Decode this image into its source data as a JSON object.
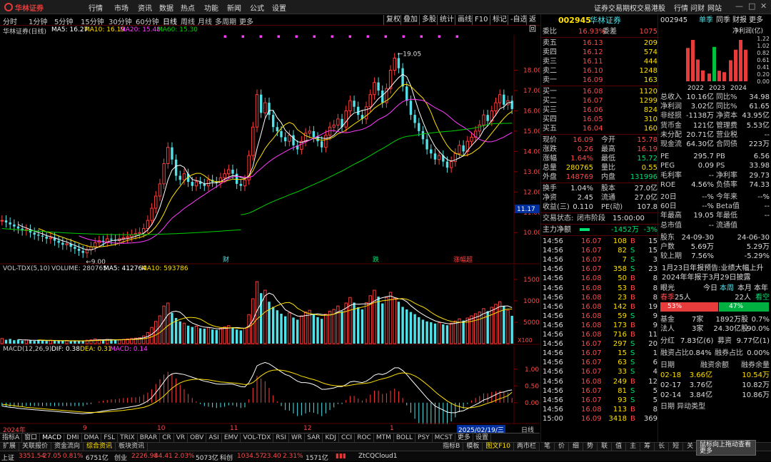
{
  "app": {
    "logo_text": "华林证券",
    "menus": [
      "行情",
      "市场",
      "资讯",
      "数据",
      "热点",
      "功能",
      "新闻",
      "公式",
      "设置"
    ],
    "right_menus": [
      "证券交易",
      "期权交易",
      "港股",
      "行情",
      "问财",
      "网站"
    ]
  },
  "periods": [
    "分时",
    "1分钟",
    "5分钟",
    "15分钟",
    "30分钟",
    "60分钟",
    "日线",
    "周线",
    "月线",
    "多周期",
    "更多"
  ],
  "active_period": "日线",
  "tools": [
    "复权",
    "叠加",
    "多股",
    "统计",
    "画线",
    "F10",
    "标记",
    "-自选",
    "返回"
  ],
  "chart_info": {
    "name": "华林证券(日线)",
    "ma5": "MA5: 16.27",
    "ma10": "MA10: 16.19",
    "ma20": "MA20: 15.48",
    "ma60": "MA60: 15.30",
    "high_label": "19.05",
    "low_label": "9.00",
    "current_price": "11.17",
    "markers": [
      "财",
      "跌",
      "涨幅超"
    ]
  },
  "vol_info": {
    "title": "VOL-TDX(5,10)",
    "volume": "VOLUME: 280765",
    "ma5": "MA5: 412764",
    "ma10": "MA10: 593786",
    "unit": "X100"
  },
  "macd_info": {
    "title": "MACD(12,26,9)",
    "dif": "DIF: 0.38",
    "dea": "DEA: 0.31",
    "macd": "MACD: 0.14"
  },
  "chart_data": [
    {
      "type": "candlestick",
      "title": "华林证券(日线)",
      "ylim": [
        9,
        20
      ],
      "yticks": [
        "18.00",
        "17.00",
        "16.00",
        "15.00",
        "14.00",
        "13.00",
        "12.00",
        "11.00",
        "10.00"
      ],
      "x_labels": [
        "2024年",
        "9",
        "10",
        "11",
        "12",
        "1",
        "2025/02/19/三"
      ],
      "series_names": [
        "MA5",
        "MA10",
        "MA20",
        "MA60"
      ],
      "colors": {
        "up": "#ff3c3c",
        "down": "#52e1e8",
        "ma5": "#ffffff",
        "ma10": "#ffe000",
        "ma20": "#ff3cff",
        "ma60": "#00d000"
      },
      "close": [
        10.6,
        10.5,
        10.4,
        10.3,
        10.2,
        10.1,
        10.15,
        10.0,
        9.9,
        9.85,
        9.8,
        9.7,
        9.75,
        9.6,
        9.5,
        9.4,
        9.45,
        9.3,
        9.2,
        9.1,
        9.0,
        9.15,
        9.3,
        9.5,
        9.6,
        9.55,
        9.7,
        9.65,
        9.6,
        9.7,
        9.75,
        9.8,
        9.9,
        9.95,
        10.0,
        10.2,
        10.6,
        11.2,
        11.8,
        12.4,
        13.4,
        14.2,
        13.6,
        12.8,
        12.6,
        12.9,
        12.5,
        12.3,
        12.5,
        12.4,
        12.3,
        12.6,
        12.5,
        12.45,
        12.7,
        12.9,
        13.1,
        12.9,
        12.4,
        12.3,
        12.6,
        13.8,
        15.2,
        16.8,
        15.9,
        16.4,
        15.8,
        15.2,
        15.0,
        14.7,
        14.5,
        14.8,
        14.3,
        14.1,
        14.5,
        14.9,
        15.0,
        14.7,
        14.5,
        14.2,
        14.8,
        15.2,
        15.3,
        15.6,
        15.2,
        16.0,
        16.5,
        16.2,
        15.8,
        15.6,
        16.2,
        16.8,
        17.4,
        17.0,
        16.4,
        17.1,
        18.0,
        18.6,
        18.1,
        17.2,
        16.5,
        15.8,
        15.4,
        15.0,
        14.6,
        14.1,
        13.9,
        13.6,
        13.8,
        13.5,
        13.2,
        13.5,
        13.9,
        14.3,
        14.0,
        14.5,
        14.7,
        15.0,
        15.3,
        15.8,
        15.5,
        16.0,
        16.4,
        16.8,
        16.3,
        16.5,
        16.09
      ],
      "volume": [
        1200,
        900,
        1100,
        800,
        950,
        700,
        850,
        750,
        650,
        900,
        700,
        600,
        800,
        650,
        700,
        600,
        750,
        550,
        650,
        700,
        600,
        800,
        900,
        1100,
        950,
        800,
        1000,
        900,
        850,
        950,
        1000,
        1100,
        1200,
        1300,
        1400,
        1800,
        2600,
        3800,
        5200,
        6500,
        8800,
        9500,
        7200,
        6000,
        5200,
        4800,
        4200,
        3900,
        4100,
        3600,
        3500,
        3800,
        3300,
        3200,
        3600,
        3900,
        4200,
        3800,
        3300,
        3100,
        3600,
        6800,
        10500,
        14500,
        11800,
        12500,
        9800,
        8600,
        7800,
        7000,
        6400,
        7200,
        6100,
        5600,
        6500,
        7400,
        7800,
        7000,
        6200,
        5800,
        6900,
        7600,
        8000,
        8800,
        7600,
        9500,
        10800,
        9600,
        8500,
        8000,
        9600,
        11200,
        12500,
        11000,
        9400,
        10800,
        12000,
        10600,
        9800,
        8600,
        8000,
        7400,
        6900,
        6200,
        5600,
        5200,
        5000,
        4700,
        4900,
        4500,
        4300,
        4800,
        5300,
        5800,
        5400,
        6000,
        6500,
        7000,
        7400,
        8200,
        7600,
        8500,
        9200,
        9800,
        8800,
        7800,
        6500
      ],
      "macd_dif": [
        -0.1,
        -0.12,
        -0.14,
        -0.15,
        -0.17,
        -0.18,
        -0.19,
        -0.2,
        -0.21,
        -0.22,
        -0.23,
        -0.24,
        -0.25,
        -0.26,
        -0.27,
        -0.28,
        -0.29,
        -0.3,
        -0.31,
        -0.32,
        -0.33,
        -0.32,
        -0.31,
        -0.29,
        -0.27,
        -0.25,
        -0.23,
        -0.21,
        -0.2,
        -0.18,
        -0.16,
        -0.14,
        -0.12,
        -0.1,
        -0.07,
        -0.02,
        0.05,
        0.15,
        0.3,
        0.45,
        0.62,
        0.78,
        0.86,
        0.88,
        0.86,
        0.84,
        0.8,
        0.76,
        0.72,
        0.68,
        0.64,
        0.62,
        0.59,
        0.56,
        0.55,
        0.55,
        0.56,
        0.55,
        0.52,
        0.48,
        0.47,
        0.6,
        0.82,
        1.1,
        1.16,
        1.2,
        1.16,
        1.08,
        1.0,
        0.92,
        0.84,
        0.8,
        0.72,
        0.64,
        0.6,
        0.6,
        0.58,
        0.54,
        0.48,
        0.4,
        0.4,
        0.42,
        0.44,
        0.48,
        0.48,
        0.54,
        0.62,
        0.64,
        0.62,
        0.6,
        0.64,
        0.72,
        0.82,
        0.86,
        0.84,
        0.88,
        0.96,
        1.04,
        1.04,
        0.96,
        0.84,
        0.7,
        0.56,
        0.42,
        0.28,
        0.14,
        0.02,
        -0.1,
        -0.16,
        -0.22,
        -0.28,
        -0.3,
        -0.3,
        -0.26,
        -0.24,
        -0.18,
        -0.12,
        -0.06,
        0.0,
        0.08,
        0.12,
        0.18,
        0.24,
        0.3,
        0.32,
        0.36,
        0.38
      ],
      "macd_dea": [
        -0.05,
        -0.06,
        -0.08,
        -0.09,
        -0.11,
        -0.12,
        -0.14,
        -0.15,
        -0.16,
        -0.17,
        -0.18,
        -0.19,
        -0.2,
        -0.21,
        -0.22,
        -0.23,
        -0.24,
        -0.25,
        -0.26,
        -0.27,
        -0.28,
        -0.29,
        -0.29,
        -0.29,
        -0.29,
        -0.28,
        -0.27,
        -0.26,
        -0.25,
        -0.24,
        -0.23,
        -0.21,
        -0.2,
        -0.18,
        -0.16,
        -0.14,
        -0.1,
        -0.05,
        0.02,
        0.1,
        0.2,
        0.32,
        0.43,
        0.52,
        0.59,
        0.64,
        0.67,
        0.69,
        0.7,
        0.7,
        0.69,
        0.68,
        0.66,
        0.64,
        0.62,
        0.61,
        0.6,
        0.59,
        0.58,
        0.56,
        0.54,
        0.55,
        0.6,
        0.7,
        0.8,
        0.88,
        0.94,
        0.97,
        0.98,
        0.97,
        0.95,
        0.92,
        0.88,
        0.84,
        0.79,
        0.76,
        0.72,
        0.69,
        0.65,
        0.6,
        0.56,
        0.53,
        0.51,
        0.5,
        0.5,
        0.5,
        0.52,
        0.54,
        0.56,
        0.57,
        0.58,
        0.6,
        0.64,
        0.68,
        0.71,
        0.74,
        0.78,
        0.83,
        0.87,
        0.89,
        0.88,
        0.85,
        0.8,
        0.73,
        0.64,
        0.54,
        0.44,
        0.33,
        0.23,
        0.14,
        0.05,
        -0.02,
        -0.08,
        -0.12,
        -0.15,
        -0.16,
        -0.15,
        -0.13,
        -0.1,
        -0.06,
        -0.02,
        0.02,
        0.07,
        0.12,
        0.16,
        0.21,
        0.31
      ]
    }
  ],
  "quote": {
    "code": "002945",
    "name": "华林证券",
    "weibi_label": "委比",
    "weibi": "16.93%",
    "weicha_label": "委差",
    "weicha": "1075",
    "sell": [
      {
        "label": "卖五",
        "price": "16.13",
        "vol": "209"
      },
      {
        "label": "卖四",
        "price": "16.12",
        "vol": "574"
      },
      {
        "label": "卖三",
        "price": "16.11",
        "vol": "444"
      },
      {
        "label": "卖二",
        "price": "16.10",
        "vol": "1248"
      },
      {
        "label": "卖一",
        "price": "16.09",
        "vol": "163"
      }
    ],
    "buy": [
      {
        "label": "买一",
        "price": "16.08",
        "vol": "1120"
      },
      {
        "label": "买二",
        "price": "16.07",
        "vol": "1299"
      },
      {
        "label": "买三",
        "price": "16.06",
        "vol": "824"
      },
      {
        "label": "买四",
        "price": "16.05",
        "vol": "310"
      },
      {
        "label": "买五",
        "price": "16.04",
        "vol": "160"
      }
    ],
    "stats": [
      {
        "l1": "现价",
        "v1": "16.09",
        "l2": "今开",
        "v2": "15.78",
        "c1": "red",
        "c2": "red"
      },
      {
        "l1": "涨跌",
        "v1": "0.26",
        "l2": "最高",
        "v2": "16.19",
        "c1": "red",
        "c2": "red"
      },
      {
        "l1": "涨幅",
        "v1": "1.64%",
        "l2": "最低",
        "v2": "15.72",
        "c1": "red",
        "c2": "green"
      },
      {
        "l1": "总量",
        "v1": "280765",
        "l2": "量比",
        "v2": "0.55",
        "c1": "yellow",
        "c2": "yellow"
      },
      {
        "l1": "外盘",
        "v1": "148769",
        "l2": "内盘",
        "v2": "131996",
        "c1": "red",
        "c2": "green"
      }
    ],
    "stats2": [
      {
        "l1": "换手",
        "v1": "1.04%",
        "l2": "股本",
        "v2": "27.0亿"
      },
      {
        "l1": "净资",
        "v1": "2.45",
        "l2": "流通",
        "v2": "27.0亿"
      },
      {
        "l1": "收益(三)",
        "v1": "0.110",
        "l2": "PE(动)",
        "v2": "107.8"
      }
    ],
    "status_label": "交易状态:",
    "status": "闭市阶段",
    "status_time": "15:00:00",
    "main_net_label": "主力净额",
    "main_net": "-1452万",
    "main_net_pct": "-3%",
    "ticks": [
      {
        "t": "14:56",
        "p": "16.07",
        "v": "108",
        "d": "B",
        "n": "15"
      },
      {
        "t": "14:56",
        "p": "16.07",
        "v": "82",
        "d": "S",
        "n": "15"
      },
      {
        "t": "14:56",
        "p": "16.07",
        "v": "7",
        "d": "S",
        "n": "3"
      },
      {
        "t": "14:56",
        "p": "16.07",
        "v": "358",
        "d": "S",
        "n": "23"
      },
      {
        "t": "14:56",
        "p": "16.08",
        "v": "50",
        "d": "B",
        "n": "8"
      },
      {
        "t": "14:56",
        "p": "16.08",
        "v": "53",
        "d": "B",
        "n": "8"
      },
      {
        "t": "14:56",
        "p": "16.08",
        "v": "23",
        "d": "B",
        "n": "8"
      },
      {
        "t": "14:56",
        "p": "16.08",
        "v": "142",
        "d": "B",
        "n": "19"
      },
      {
        "t": "14:56",
        "p": "16.08",
        "v": "59",
        "d": "S",
        "n": "9"
      },
      {
        "t": "14:56",
        "p": "16.08",
        "v": "173",
        "d": "B",
        "n": "9"
      },
      {
        "t": "14:56",
        "p": "16.08",
        "v": "716",
        "d": "B",
        "n": "11"
      },
      {
        "t": "14:56",
        "p": "16.07",
        "v": "297",
        "d": "S",
        "n": "20"
      },
      {
        "t": "14:56",
        "p": "16.07",
        "v": "15",
        "d": "S",
        "n": "1"
      },
      {
        "t": "14:56",
        "p": "16.07",
        "v": "63",
        "d": "S",
        "n": "6"
      },
      {
        "t": "14:56",
        "p": "16.07",
        "v": "33",
        "d": "S",
        "n": "4"
      },
      {
        "t": "14:56",
        "p": "16.08",
        "v": "249",
        "d": "B",
        "n": "12"
      },
      {
        "t": "14:56",
        "p": "16.07",
        "v": "81",
        "d": "S",
        "n": "5"
      },
      {
        "t": "14:56",
        "p": "16.07",
        "v": "93",
        "d": "S",
        "n": "5"
      },
      {
        "t": "14:56",
        "p": "16.08",
        "v": "113",
        "d": "B",
        "n": "8"
      },
      {
        "t": "15:00",
        "p": "16.09",
        "v": "3418",
        "d": "B",
        "n": "369"
      }
    ]
  },
  "fin": {
    "code": "002945",
    "tabs": [
      "单季",
      "同季",
      "财报",
      "更多"
    ],
    "chart_title": "净利润(亿)",
    "years": [
      "2022",
      "2023",
      "2024"
    ],
    "yaxis": [
      "1.22",
      "1.02",
      "0.82",
      "0.61",
      "0.41",
      "0.20",
      "0.00"
    ],
    "bars": [
      0.95,
      1.18,
      0.62,
      0.31,
      0.22,
      0.98,
      0.3,
      0.26,
      0.6,
      0.9,
      1.18,
      0.9
    ],
    "rows1": [
      {
        "l1": "总收入",
        "v1": "10.16亿",
        "l2": "同比%",
        "v2": "34.98"
      },
      {
        "l1": "净利润",
        "v1": "3.02亿",
        "l2": "同比%",
        "v2": "61.65"
      },
      {
        "l1": "非经损",
        "v1": "-1138万",
        "l2": "净资本",
        "v2": "43.95亿"
      },
      {
        "l1": "货币金",
        "v1": "121亿",
        "l2": "管理费",
        "v2": "5.53亿"
      },
      {
        "l1": "未分配",
        "v1": "20.71亿",
        "l2": "营业税",
        "v2": "--"
      },
      {
        "l1": "现金流",
        "v1": "64.30亿",
        "l2": "合同债",
        "v2": "223万"
      }
    ],
    "rows2": [
      {
        "l1": "PE",
        "v1": "295.7",
        "l2": "PB",
        "v2": "6.56"
      },
      {
        "l1": "PEG",
        "v1": "0.09",
        "l2": "PS",
        "v2": "33.98"
      },
      {
        "l1": "毛利率",
        "v1": "--",
        "l2": "净利率",
        "v2": "29.73"
      },
      {
        "l1": "ROE",
        "v1": "4.56%",
        "l2": "负债率",
        "v2": "74.33"
      }
    ],
    "rows3": [
      {
        "l1": "20日",
        "v1": "--%",
        "l2": "今年来",
        "v2": "--%"
      },
      {
        "l1": "60日",
        "v1": "--%",
        "l2": "Beta值",
        "v2": "--"
      },
      {
        "l1": "年最高",
        "v1": "19.05",
        "l2": "年最低",
        "v2": "--"
      },
      {
        "l1": "总市值",
        "v1": "--",
        "l2": "流通值",
        "v2": ""
      }
    ],
    "holders_head": {
      "l": "股东",
      "a": "24-09-30",
      "b": "24-06-30"
    },
    "holders": [
      {
        "l": "户数",
        "a": "5.69万",
        "b": "5.29万"
      },
      {
        "l": "较上期",
        "a": "7.56%",
        "b": "-5.29%"
      }
    ],
    "notice1": "1月23日年报预告:业绩大幅上升",
    "notice2": "2024年年报于3月29日披露",
    "sentiment_label": "眼光",
    "sentiment_tabs": [
      "今日",
      "本周",
      "本月",
      "本年"
    ],
    "spring": "春季",
    "bull_count": "25人",
    "bear_count": "22人",
    "bear_label": "看空",
    "bull_pct": "53%",
    "bear_pct": "47%",
    "funds": [
      {
        "l": "基金",
        "a": "7家",
        "b": "1892万股",
        "c": "0.7%"
      },
      {
        "l": "法人",
        "a": "3家",
        "b": "24.30亿股",
        "c": "90.0%"
      }
    ],
    "dividend": {
      "l": "分红",
      "a": "7.83亿(6)",
      "b": "募资",
      "c": "9.77亿(1)"
    },
    "margin": {
      "l": "融资占比",
      "a": "0.84%",
      "b": "融券占比",
      "c": "0.00%"
    },
    "margin_head": {
      "l": "日期",
      "a": "融资余额",
      "b": "融券余量"
    },
    "margin_rows": [
      {
        "d": "02-18",
        "a": "3.66亿",
        "b": "10.54万"
      },
      {
        "d": "02-17",
        "a": "3.76亿",
        "b": "10.82万"
      },
      {
        "d": "02-14",
        "a": "3.84亿",
        "b": "10.86万"
      }
    ],
    "last_row": "日期  异动类型"
  },
  "tooltip": "鼠标向上拖动查看更多",
  "indicator_tabs": [
    "指标A",
    "窗口",
    "MACD",
    "DMI",
    "DMA",
    "FSL",
    "TRIX",
    "BRAR",
    "CR",
    "VR",
    "OBV",
    "ASI",
    "EMV",
    "VOL-TDX",
    "RSI",
    "WR",
    "SAR",
    "KDJ",
    "CCI",
    "ROC",
    "MTM",
    "BOLL",
    "PSY",
    "MCST",
    "更多",
    "设置"
  ],
  "sub_tabs": [
    "扩展",
    "关联报价",
    "资金流向",
    "综合资讯",
    "板块资讯"
  ],
  "right_tabs": [
    "指标B",
    "模板"
  ],
  "bottom_tabs2": [
    "笔",
    "价",
    "细",
    "势",
    "联",
    "值",
    "主",
    "筹",
    "长",
    "短",
    "关",
    "五"
  ],
  "f10_label": "图文F10",
  "compare_label": "两市栏",
  "period_label": "日线",
  "status": {
    "sh_label": "上证",
    "sh": "3351.54",
    "sh_chg": "27.05",
    "sh_pct": "0.81%",
    "sh_amt": "6751亿",
    "cy_label": "创业",
    "cy": "2226.98",
    "cy_chg": "44.41",
    "cy_pct": "2.03%",
    "cy_amt": "5073亿",
    "kc_label": "科创",
    "kc": "1034.57",
    "kc_chg": "23.40",
    "kc_pct": "2.31%",
    "kc_amt": "1571亿",
    "cloud": "ZtCQCloud1"
  }
}
